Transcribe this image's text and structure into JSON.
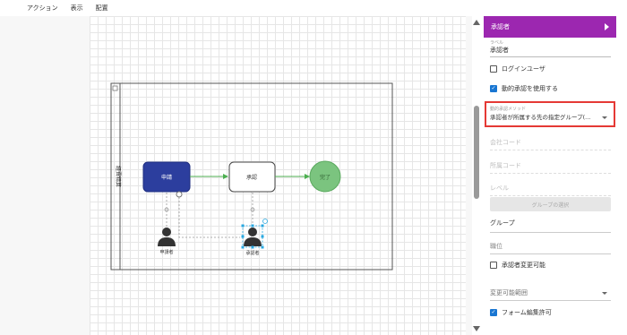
{
  "menu": {
    "action": "アクション",
    "view": "表示",
    "arrange": "配置"
  },
  "diagram": {
    "lane_label": "経費精算",
    "node_apply": "申請",
    "node_approve": "承認",
    "node_done": "完了",
    "actor_applicant": "申請者",
    "actor_approver": "承認者",
    "colors": {
      "apply_fill": "#2c3e9e",
      "done_fill": "#7bc47f",
      "selection": "#29a8e0"
    }
  },
  "panel": {
    "header_title": "承認者",
    "label_caption": "ラベル",
    "label_value": "承認者",
    "login_user": "ログインユーザ",
    "dynamic_approver": "動的承認を使用する",
    "method_caption": "動的承認メソッド",
    "method_value": "承認者が所属する先の指定グループ(...",
    "company_code": "会社コード",
    "dept_code": "所属コード",
    "level": "レベル",
    "group_select_button": "グループの選択",
    "group": "グループ",
    "position": "職位",
    "approver_changeable": "承認者変更可能",
    "change_range": "変更可能範囲",
    "form_edit": "フォーム編集許可",
    "header_color": "#9c27b0",
    "check_color": "#1976d2"
  }
}
